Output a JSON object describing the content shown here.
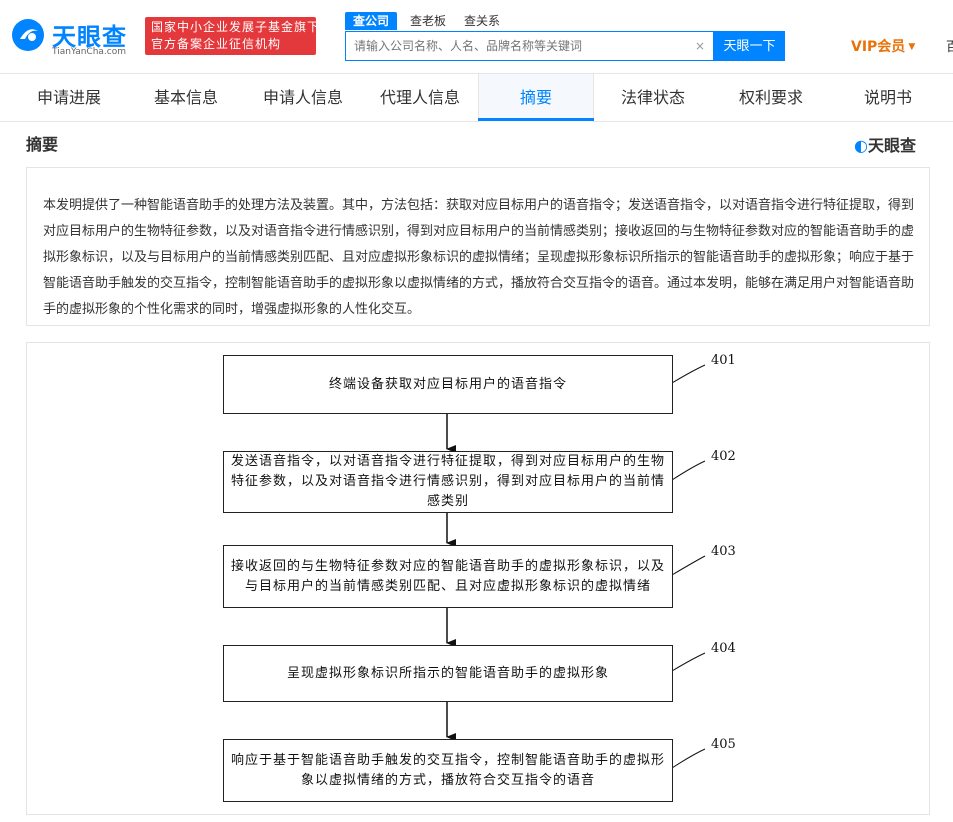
{
  "header": {
    "logo_text": "天眼查",
    "logo_sub": "TianYanCha.com",
    "banner_line1": "国家中小企业发展子基金旗下",
    "banner_line2": "官方备案企业征信机构",
    "search_tabs": [
      "查公司",
      "查老板",
      "查关系"
    ],
    "search_placeholder": "请输入公司名称、人名、品牌名称等关键词",
    "search_clear": "×",
    "search_button": "天眼一下",
    "vip_label": "VIP会员",
    "edge_text": "百"
  },
  "nav": {
    "tabs": [
      "申请进展",
      "基本信息",
      "申请人信息",
      "代理人信息",
      "摘要",
      "法律状态",
      "权利要求",
      "说明书"
    ],
    "active_index": 4
  },
  "section": {
    "title": "摘要",
    "brand_mark": "天眼查"
  },
  "abstract": {
    "text": "本发明提供了一种智能语音助手的处理方法及装置。其中，方法包括：获取对应目标用户的语音指令；发送语音指令，以对语音指令进行特征提取，得到对应目标用户的生物特征参数，以及对语音指令进行情感识别，得到对应目标用户的当前情感类别；接收返回的与生物特征参数对应的智能语音助手的虚拟形象标识，以及与目标用户的当前情感类别匹配、且对应虚拟形象标识的虚拟情绪；呈现虚拟形象标识所指示的智能语音助手的虚拟形象；响应于基于智能语音助手触发的交互指令，控制智能语音助手的虚拟形象以虚拟情绪的方式，播放符合交互指令的语音。通过本发明，能够在满足用户对智能语音助手的虚拟形象的个性化需求的同时，增强虚拟形象的人性化交互。"
  },
  "flowchart": {
    "steps": [
      {
        "label": "401",
        "text": "终端设备获取对应目标用户的语音指令"
      },
      {
        "label": "402",
        "text": "发送语音指令，以对语音指令进行特征提取，得到对应目标用户的生物特征参数，以及对语音指令进行情感识别，得到对应目标用户的当前情感类别"
      },
      {
        "label": "403",
        "text": "接收返回的与生物特征参数对应的智能语音助手的虚拟形象标识，以及与目标用户的当前情感类别匹配、且对应虚拟形象标识的虚拟情绪"
      },
      {
        "label": "404",
        "text": "呈现虚拟形象标识所指示的智能语音助手的虚拟形象"
      },
      {
        "label": "405",
        "text": "响应于基于智能语音助手触发的交互指令，控制智能语音助手的虚拟形象以虚拟情绪的方式，播放符合交互指令的语音"
      }
    ]
  },
  "colors": {
    "brand_blue": "#0084ff",
    "banner_red": "#e4393c",
    "vip_orange": "#e9720b"
  }
}
